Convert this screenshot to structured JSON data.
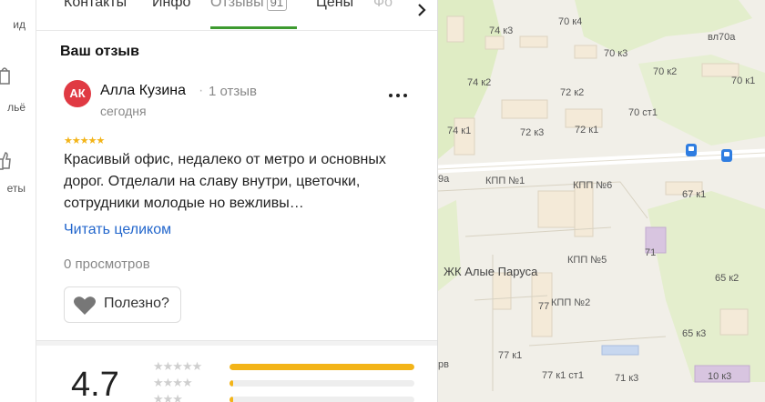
{
  "leftnav": {
    "items": [
      {
        "label": "ид"
      },
      {
        "label": "льё"
      },
      {
        "label": "еты"
      }
    ]
  },
  "tabs": {
    "items": [
      {
        "label": "Контакты"
      },
      {
        "label": "Инфо"
      },
      {
        "label": "Отзывы",
        "count": "91"
      },
      {
        "label": "Цены"
      },
      {
        "label": "Фо"
      }
    ],
    "active": "Отзывы"
  },
  "review": {
    "section_title": "Ваш отзыв",
    "avatar_initials": "АК",
    "avatar_color": "#e03a43",
    "author": "Алла Кузина",
    "separator": "·",
    "author_reviews": "1 отзыв",
    "date": "сегодня",
    "stars": "★★★★★",
    "rating": 5,
    "text": "Красивый офис, недалеко от метро и основных дорог. Отделали на славу внутри, цветочки, сотрудники молодые но вежливы…",
    "read_more": "Читать целиком",
    "views": "0 просмотров",
    "useful_label": "Полезно?"
  },
  "summary": {
    "rating": "4.7",
    "distribution": [
      {
        "stars": "★★★★★",
        "share": 1.0
      },
      {
        "stars": "★★★★",
        "share": 0.02
      },
      {
        "stars": "★★★",
        "share": 0.02
      }
    ],
    "bar_color": "#f3b418"
  },
  "map": {
    "labels": [
      "74 к3",
      "70 к4",
      "вл70а",
      "70 к3",
      "70 к2",
      "74 к2",
      "72 к2",
      "70 к1",
      "70 ст1",
      "74 к1",
      "72 к3",
      "72 к1",
      "67 к1",
      "КПП №1",
      "КПП №6",
      "9а",
      "КПП №5",
      "71",
      "ЖК Алые Паруса",
      "65 к2",
      "КПП №2",
      "65 к3",
      "77",
      "77 к1",
      "77 к1 ст1",
      "71 к3",
      "10 к3",
      "рв"
    ]
  }
}
